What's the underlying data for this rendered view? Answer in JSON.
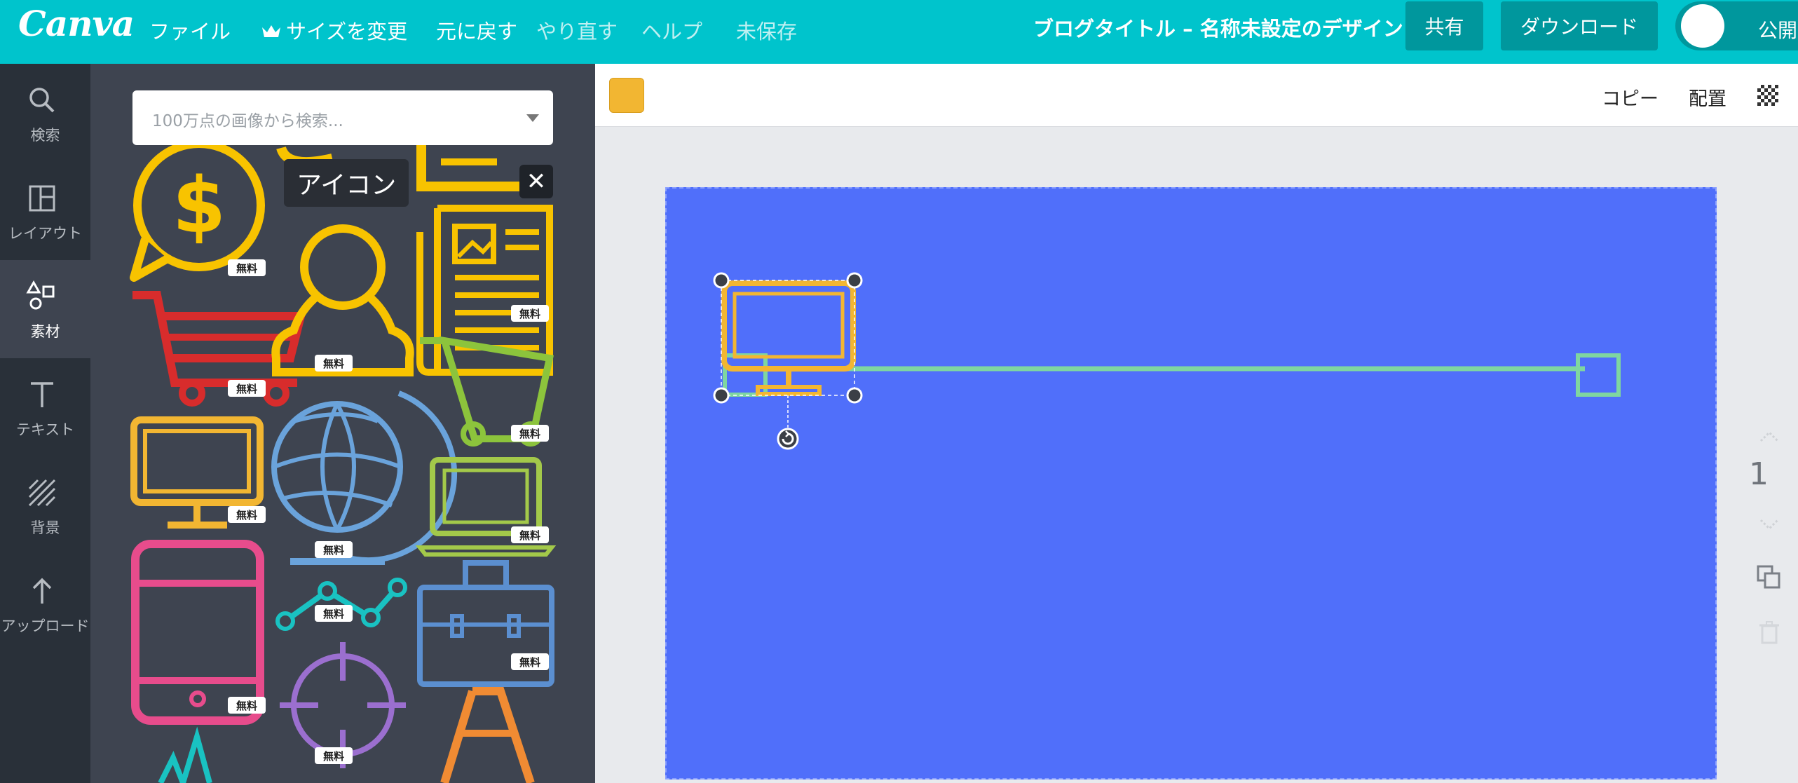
{
  "topbar": {
    "logo": "Canva",
    "menu": [
      {
        "label": "ファイル"
      },
      {
        "label": "サイズを変更"
      },
      {
        "label": "元に戻す"
      },
      {
        "label": "やり直す"
      },
      {
        "label": "ヘルプ"
      }
    ],
    "save_status": "未保存",
    "doc_title": "ブログタイトル – 名称未設定のデザイン",
    "share_label": "共有",
    "download_label": "ダウンロード",
    "publish_label": "公開"
  },
  "leftnav": {
    "items": [
      {
        "label": "検索",
        "icon": "search-icon"
      },
      {
        "label": "レイアウト",
        "icon": "layout-icon"
      },
      {
        "label": "素材",
        "icon": "elements-icon",
        "active": true
      },
      {
        "label": "テキスト",
        "icon": "text-icon"
      },
      {
        "label": "背景",
        "icon": "background-icon"
      },
      {
        "label": "アップロード",
        "icon": "upload-icon"
      }
    ]
  },
  "panel": {
    "search_placeholder": "100万点の画像から検索...",
    "tooltip": "アイコン",
    "close_icon": "✕",
    "free_badge": "無料",
    "icons": [
      "dollar-bubble-icon",
      "cart-red-icon",
      "monitor-yellow-icon",
      "tablet-icon",
      "user-icon",
      "globe-icon",
      "line-chart-icon",
      "crosshair-icon",
      "newspaper-icon",
      "cart-green-icon",
      "laptop-icon",
      "briefcase-icon",
      "traffic-cone-icon",
      "pulse-icon"
    ]
  },
  "editor": {
    "swatch_color": "#f2b632",
    "copy_label": "コピー",
    "arrange_label": "配置",
    "page_number": "1",
    "canvas_color": "#506ffa"
  }
}
